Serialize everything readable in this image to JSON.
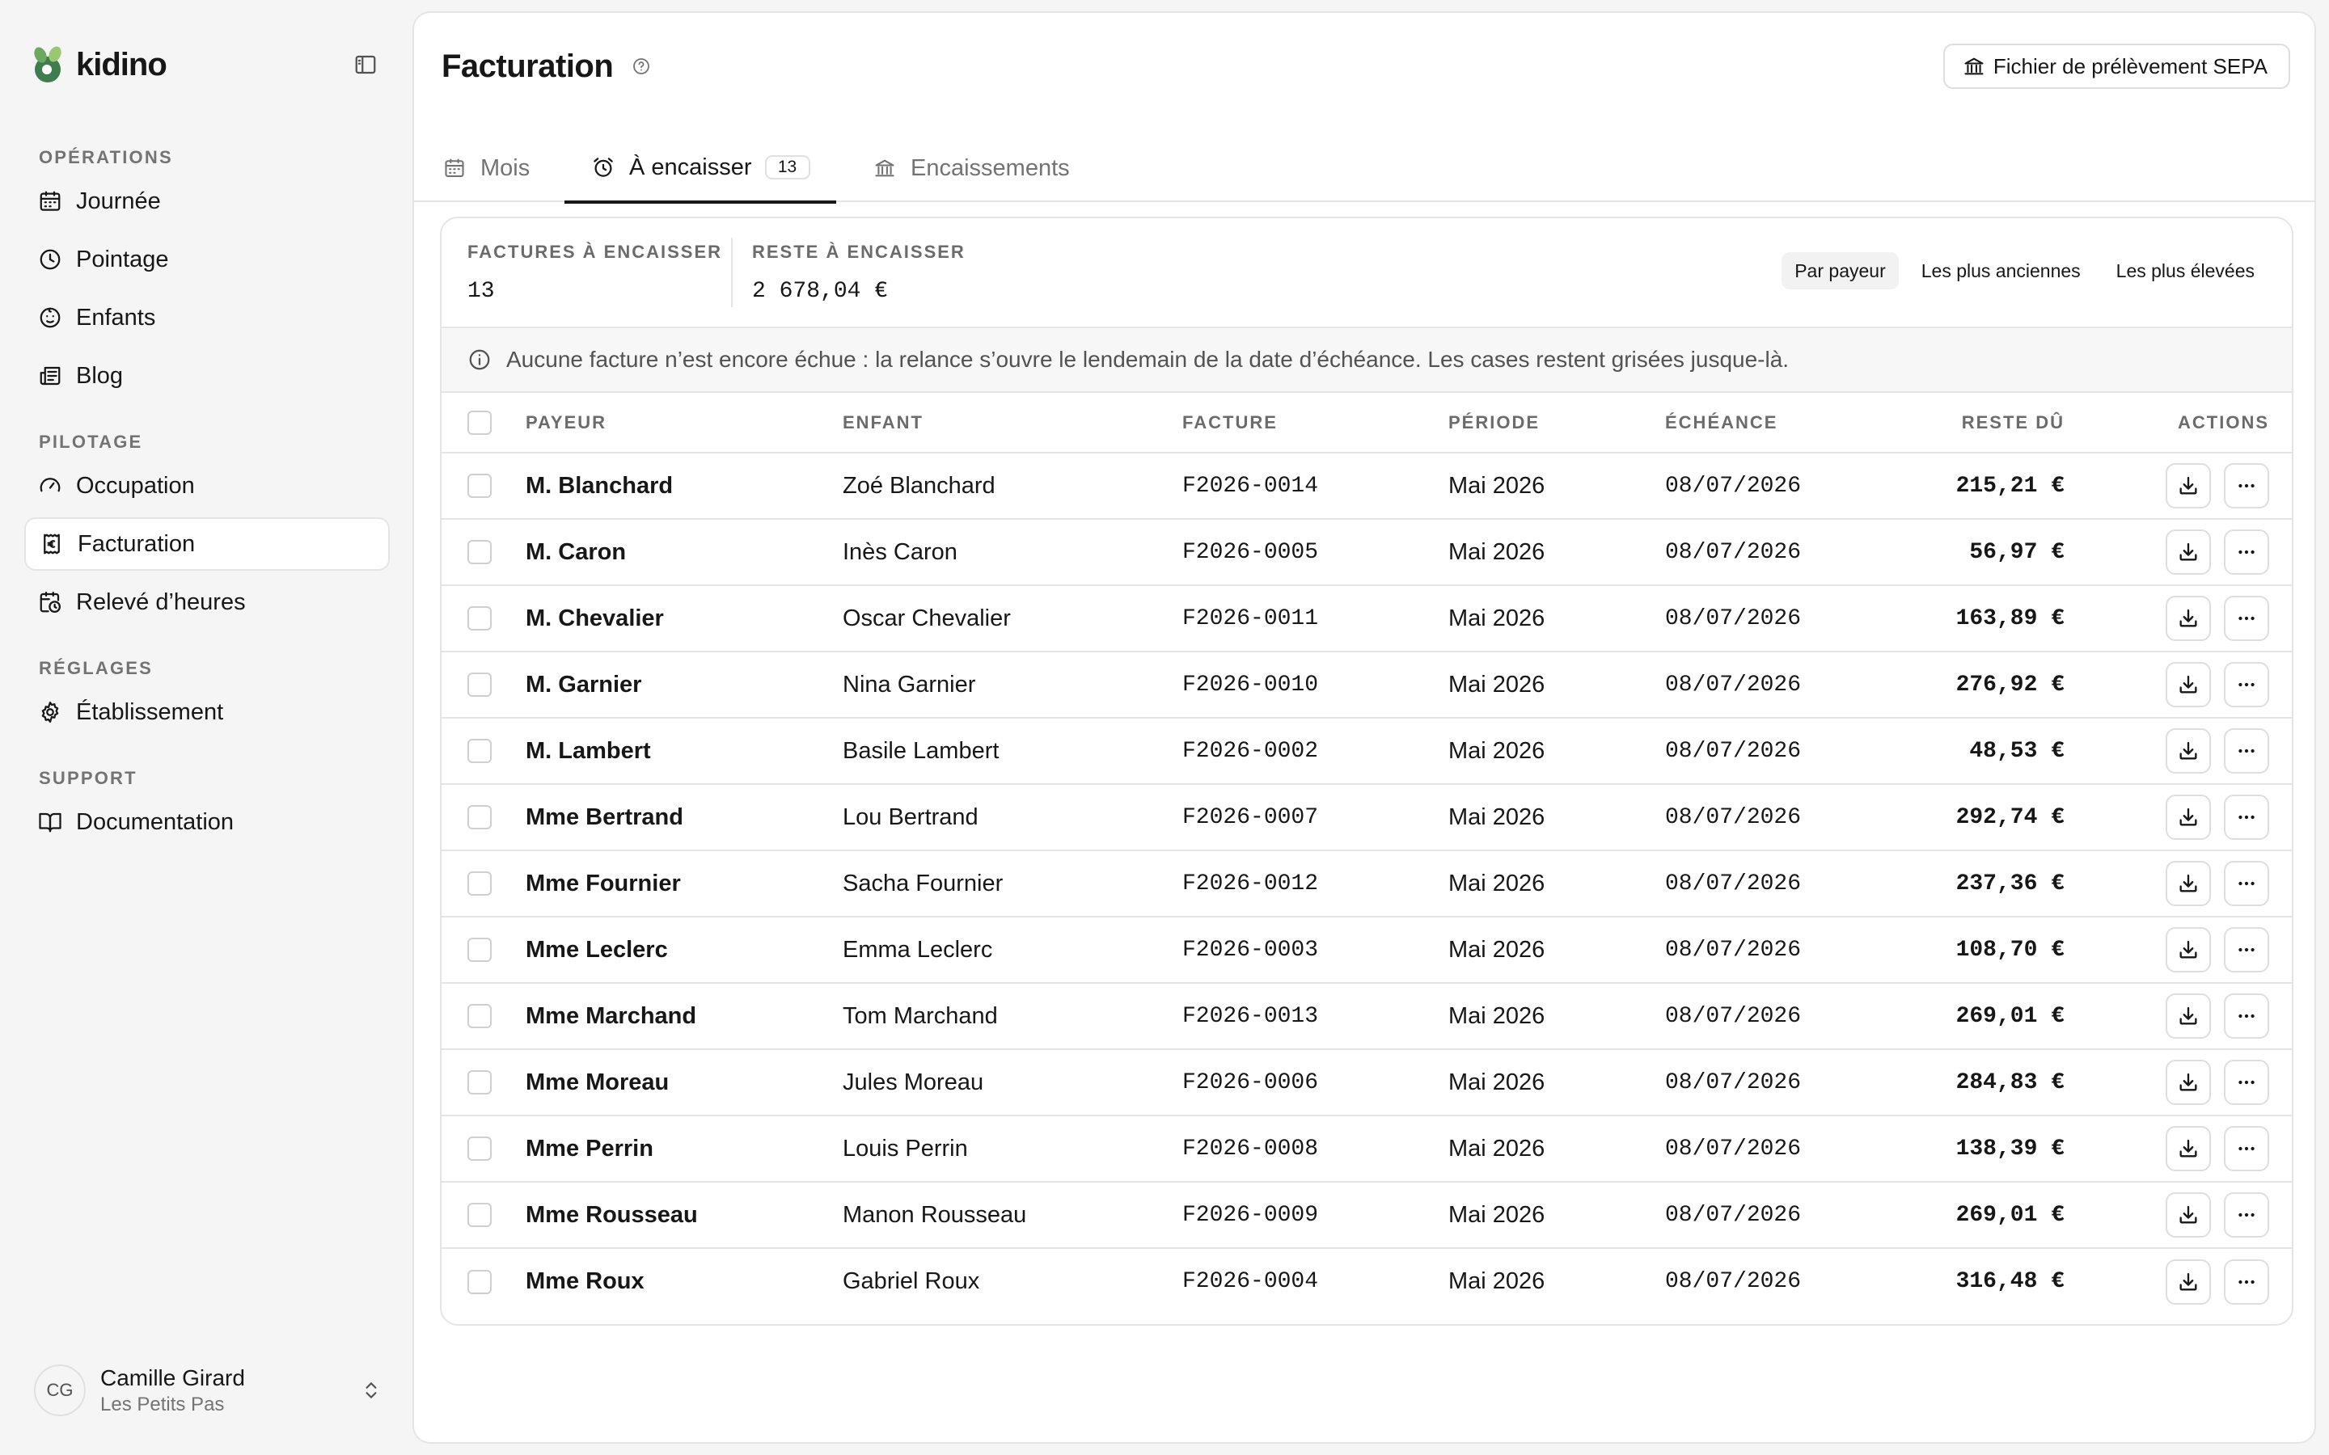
{
  "brand": {
    "name": "kidino"
  },
  "sidebar": {
    "sections": [
      {
        "title": "OPÉRATIONS",
        "items": [
          {
            "label": "Journée",
            "icon": "calendar-icon"
          },
          {
            "label": "Pointage",
            "icon": "clock-icon"
          },
          {
            "label": "Enfants",
            "icon": "baby-face-icon"
          },
          {
            "label": "Blog",
            "icon": "newspaper-icon"
          }
        ]
      },
      {
        "title": "PILOTAGE",
        "items": [
          {
            "label": "Occupation",
            "icon": "gauge-icon"
          },
          {
            "label": "Facturation",
            "icon": "receipt-euro-icon",
            "active": true
          },
          {
            "label": "Relevé d’heures",
            "icon": "calendar-clock-icon"
          }
        ]
      },
      {
        "title": "RÉGLAGES",
        "items": [
          {
            "label": "Établissement",
            "icon": "gear-icon"
          }
        ]
      },
      {
        "title": "SUPPORT",
        "items": [
          {
            "label": "Documentation",
            "icon": "book-icon"
          }
        ]
      }
    ]
  },
  "user": {
    "initials": "CG",
    "name": "Camille Girard",
    "org": "Les Petits Pas"
  },
  "header": {
    "title": "Facturation",
    "sepa_label": "Fichier de prélèvement SEPA"
  },
  "tabs": [
    {
      "label": "Mois",
      "icon": "calendar-icon"
    },
    {
      "label": "À encaisser",
      "icon": "alarm-clock-icon",
      "count": "13",
      "active": true
    },
    {
      "label": "Encaissements",
      "icon": "bank-icon"
    }
  ],
  "stats": {
    "factures_label": "FACTURES À ENCAISSER",
    "factures_value": "13",
    "reste_label": "RESTE À ENCAISSER",
    "reste_value": "2 678,04 €"
  },
  "sorts": [
    {
      "label": "Par payeur",
      "active": true
    },
    {
      "label": "Les plus anciennes",
      "active": false
    },
    {
      "label": "Les plus élevées",
      "active": false
    }
  ],
  "notice": "Aucune facture n’est encore échue : la relance s’ouvre le lendemain de la date d’échéance. Les cases restent grisées jusque-là.",
  "table": {
    "headers": {
      "payeur": "PAYEUR",
      "enfant": "ENFANT",
      "facture": "FACTURE",
      "periode": "PÉRIODE",
      "echeance": "ÉCHÉANCE",
      "reste": "RESTE DÛ",
      "actions": "ACTIONS"
    },
    "rows": [
      {
        "payeur": "M. Blanchard",
        "enfant": "Zoé Blanchard",
        "facture": "F2026-0014",
        "periode": "Mai 2026",
        "echeance": "08/07/2026",
        "reste": "215,21 €"
      },
      {
        "payeur": "M. Caron",
        "enfant": "Inès Caron",
        "facture": "F2026-0005",
        "periode": "Mai 2026",
        "echeance": "08/07/2026",
        "reste": "56,97 €"
      },
      {
        "payeur": "M. Chevalier",
        "enfant": "Oscar Chevalier",
        "facture": "F2026-0011",
        "periode": "Mai 2026",
        "echeance": "08/07/2026",
        "reste": "163,89 €"
      },
      {
        "payeur": "M. Garnier",
        "enfant": "Nina Garnier",
        "facture": "F2026-0010",
        "periode": "Mai 2026",
        "echeance": "08/07/2026",
        "reste": "276,92 €"
      },
      {
        "payeur": "M. Lambert",
        "enfant": "Basile Lambert",
        "facture": "F2026-0002",
        "periode": "Mai 2026",
        "echeance": "08/07/2026",
        "reste": "48,53 €"
      },
      {
        "payeur": "Mme Bertrand",
        "enfant": "Lou Bertrand",
        "facture": "F2026-0007",
        "periode": "Mai 2026",
        "echeance": "08/07/2026",
        "reste": "292,74 €"
      },
      {
        "payeur": "Mme Fournier",
        "enfant": "Sacha Fournier",
        "facture": "F2026-0012",
        "periode": "Mai 2026",
        "echeance": "08/07/2026",
        "reste": "237,36 €"
      },
      {
        "payeur": "Mme Leclerc",
        "enfant": "Emma Leclerc",
        "facture": "F2026-0003",
        "periode": "Mai 2026",
        "echeance": "08/07/2026",
        "reste": "108,70 €"
      },
      {
        "payeur": "Mme Marchand",
        "enfant": "Tom Marchand",
        "facture": "F2026-0013",
        "periode": "Mai 2026",
        "echeance": "08/07/2026",
        "reste": "269,01 €"
      },
      {
        "payeur": "Mme Moreau",
        "enfant": "Jules Moreau",
        "facture": "F2026-0006",
        "periode": "Mai 2026",
        "echeance": "08/07/2026",
        "reste": "284,83 €"
      },
      {
        "payeur": "Mme Perrin",
        "enfant": "Louis Perrin",
        "facture": "F2026-0008",
        "periode": "Mai 2026",
        "echeance": "08/07/2026",
        "reste": "138,39 €"
      },
      {
        "payeur": "Mme Rousseau",
        "enfant": "Manon Rousseau",
        "facture": "F2026-0009",
        "periode": "Mai 2026",
        "echeance": "08/07/2026",
        "reste": "269,01 €"
      },
      {
        "payeur": "Mme Roux",
        "enfant": "Gabriel Roux",
        "facture": "F2026-0004",
        "periode": "Mai 2026",
        "echeance": "08/07/2026",
        "reste": "316,48 €"
      }
    ]
  }
}
